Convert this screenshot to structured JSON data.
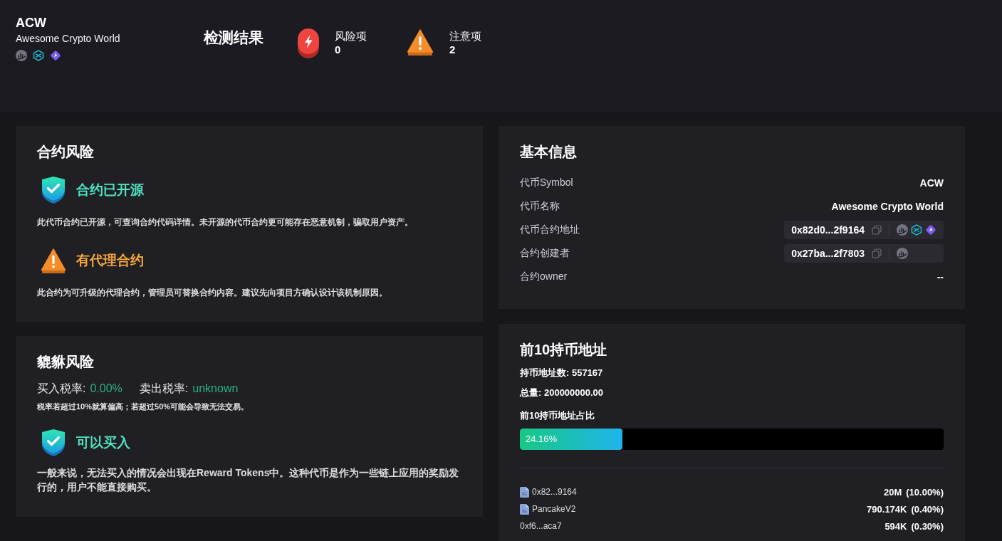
{
  "token": {
    "symbol": "ACW",
    "name": "Awesome Crypto World",
    "links": [
      {
        "kind": "chart"
      },
      {
        "kind": "hexagon"
      },
      {
        "kind": "diamond"
      }
    ]
  },
  "summary": {
    "title": "检测结果",
    "counters": [
      {
        "kind": "risk",
        "label": "风险项",
        "count": "0"
      },
      {
        "kind": "warning",
        "label": "注意项",
        "count": "2"
      }
    ]
  },
  "contract_risk": {
    "title": "合约风险",
    "items": [
      {
        "kind": "safe",
        "title": "合约已开源",
        "description": "此代币合约已开源，可查询合约代码详情。未开源的代币合约更可能存在恶意机制，骗取用户资产。"
      },
      {
        "kind": "warning",
        "title": "有代理合约",
        "description": "此合约为可升级的代理合约，管理员可替换合约内容。建议先向项目方确认设计该机制原因。"
      }
    ]
  },
  "honeypot_risk": {
    "title": "貔貅风险",
    "taxes": [
      {
        "label": "买入税率:",
        "value": "0.00%"
      },
      {
        "label": "卖出税率:",
        "value": "unknown"
      }
    ],
    "note": "税率若超过10%就算偏高；若超过50%可能会导致无法交易。",
    "items": [
      {
        "kind": "safe",
        "title": "可以买入",
        "description": "一般来说，无法买入的情况会出现在Reward Tokens中。这种代币是作为一些链上应用的奖励发行的，用户不能直接购买。"
      }
    ]
  },
  "basic_info": {
    "title": "基本信息",
    "rows": [
      {
        "kind": "text",
        "label": "代币Symbol",
        "value": "ACW"
      },
      {
        "kind": "text",
        "label": "代币名称",
        "value": "Awesome Crypto World"
      },
      {
        "kind": "address",
        "label": "代币合约地址",
        "value": "0x82d0...2f9164",
        "links": [
          {
            "kind": "chart"
          },
          {
            "kind": "hexagon"
          },
          {
            "kind": "diamond"
          }
        ]
      },
      {
        "kind": "address",
        "label": "合约创建者",
        "value": "0x27ba...2f7803",
        "links": [
          {
            "kind": "chart"
          }
        ]
      },
      {
        "kind": "text",
        "label": "合约owner",
        "value": "--"
      }
    ]
  },
  "holders": {
    "title": "前10持币地址",
    "stats": [
      "持币地址数: 557167",
      "总量: 200000000.00"
    ],
    "share": {
      "label": "前10持币地址占比",
      "level": 0.2416,
      "reading": "24.16%"
    },
    "rows": [
      {
        "kind": "contract",
        "address": "0x82...9164",
        "amount": "20M",
        "share": "(10.00%)"
      },
      {
        "kind": "contract",
        "address": "PancakeV2",
        "amount": "790.174K",
        "share": "(0.40%)"
      },
      {
        "kind": "wallet",
        "address": "0xf6...aca7",
        "amount": "594K",
        "share": "(0.30%)"
      }
    ]
  }
}
